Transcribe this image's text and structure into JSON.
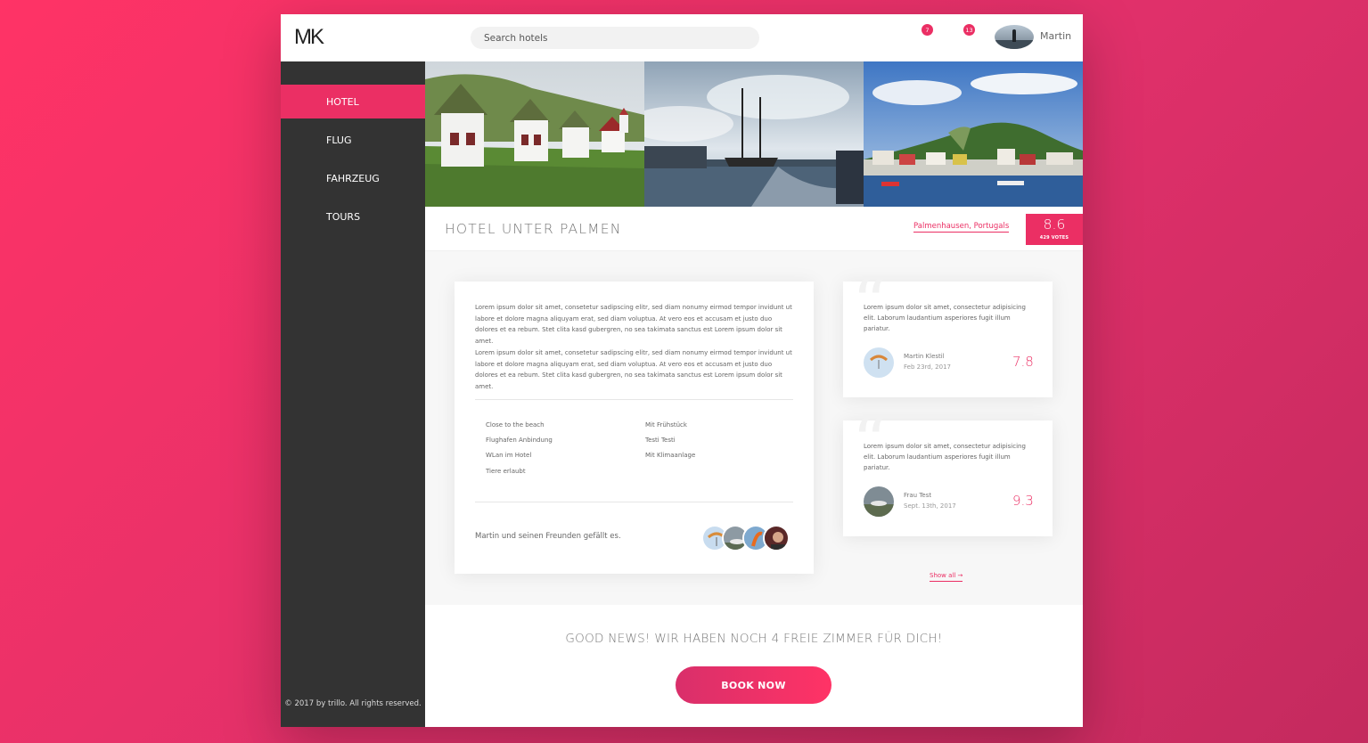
{
  "header": {
    "logo": "MK",
    "search_placeholder": "Search hotels",
    "bookmark_count": "7",
    "chat_count": "13",
    "user_name": "Martin"
  },
  "sidebar": {
    "items": [
      {
        "label": "HOTEL",
        "active": true
      },
      {
        "label": "FLUG",
        "active": false
      },
      {
        "label": "FAHRZEUG",
        "active": false
      },
      {
        "label": "TOURS",
        "active": false
      }
    ],
    "legal": "© 2017 by trillo. All rights reserved."
  },
  "hotel": {
    "title": "HOTEL UNTER PALMEN",
    "location": "Palmenhausen, Portugals",
    "rating": "8.6",
    "votes": "429 VOTES"
  },
  "description": {
    "paragraphs": [
      "Lorem ipsum dolor sit amet, consetetur sadipscing elitr, sed diam nonumy eirmod tempor invidunt ut labore et dolore magna aliquyam erat, sed diam voluptua. At vero eos et accusam et justo duo dolores et ea rebum. Stet clita kasd gubergren, no sea takimata sanctus est Lorem ipsum dolor sit amet.",
      "Lorem ipsum dolor sit amet, consetetur sadipscing elitr, sed diam nonumy eirmod tempor invidunt ut labore et dolore magna aliquyam erat, sed diam voluptua. At vero eos et accusam et justo duo dolores et ea rebum. Stet clita kasd gubergren, no sea takimata sanctus est Lorem ipsum dolor sit amet."
    ],
    "features": [
      "Close to the beach",
      "Mit Frühstück",
      "Flughafen Anbindung",
      "Testi Testi",
      "WLan im Hotel",
      "Mit Klimaanlage",
      "Tiere erlaubt"
    ],
    "likes_text": "Martin und seinen Freunden gefällt es."
  },
  "reviews": [
    {
      "text": "Lorem ipsum dolor sit amet, consectetur adipisicing elit. Laborum laudantium asperiores fugit illum pariatur.",
      "name": "Martin Klestil",
      "date": "Feb 23rd, 2017",
      "score": "7.8"
    },
    {
      "text": "Lorem ipsum dolor sit amet, consectetur adipisicing elit. Laborum laudantium asperiores fugit illum pariatur.",
      "name": "Frau Test",
      "date": "Sept. 13th, 2017",
      "score": "9.3"
    }
  ],
  "show_all": "Show all →",
  "cta": {
    "text": "GOOD NEWS! WIR HABEN NOCH 4 FREIE ZIMMER FÜR DICH!",
    "button": "BOOK NOW"
  },
  "colors": {
    "accent": "#eb2f64",
    "sidebar": "#333333"
  }
}
